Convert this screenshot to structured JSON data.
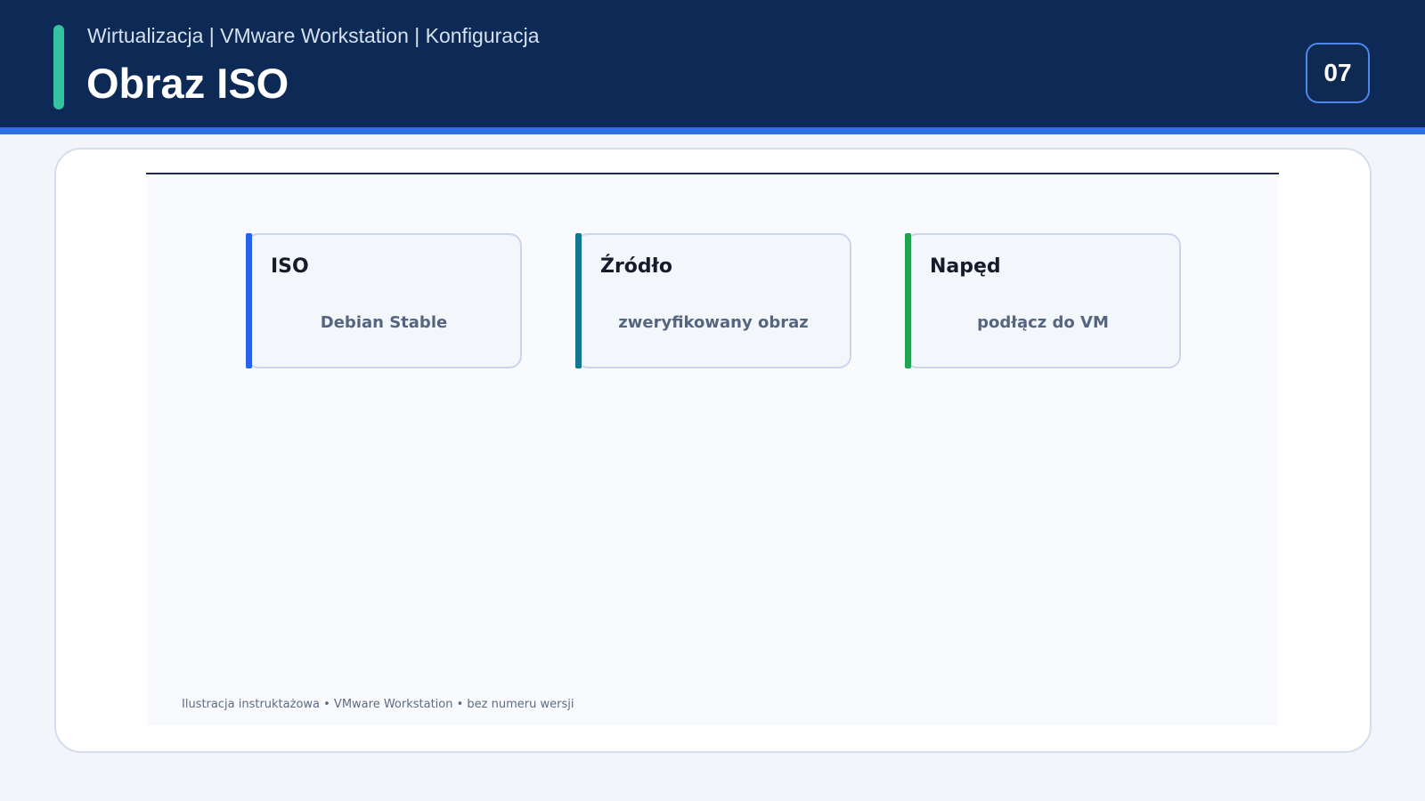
{
  "header": {
    "breadcrumb": "Wirtualizacja | VMware Workstation | Konfiguracja",
    "title": "Obraz ISO",
    "slide_number": "07"
  },
  "cards": [
    {
      "title": "ISO",
      "value": "Debian Stable",
      "accent_color": "#2563eb"
    },
    {
      "title": "Źródło",
      "value": "zweryfikowany obraz",
      "accent_color": "#13778f"
    },
    {
      "title": "Napęd",
      "value": "podłącz do VM",
      "accent_color": "#1ea453"
    }
  ],
  "footnote": "Ilustracja instruktażowa • VMware Workstation • bez numeru wersji",
  "colors": {
    "header_bg": "#0c2a55",
    "header_rule": "#2e6fe6",
    "accent": "#35c2a0"
  }
}
